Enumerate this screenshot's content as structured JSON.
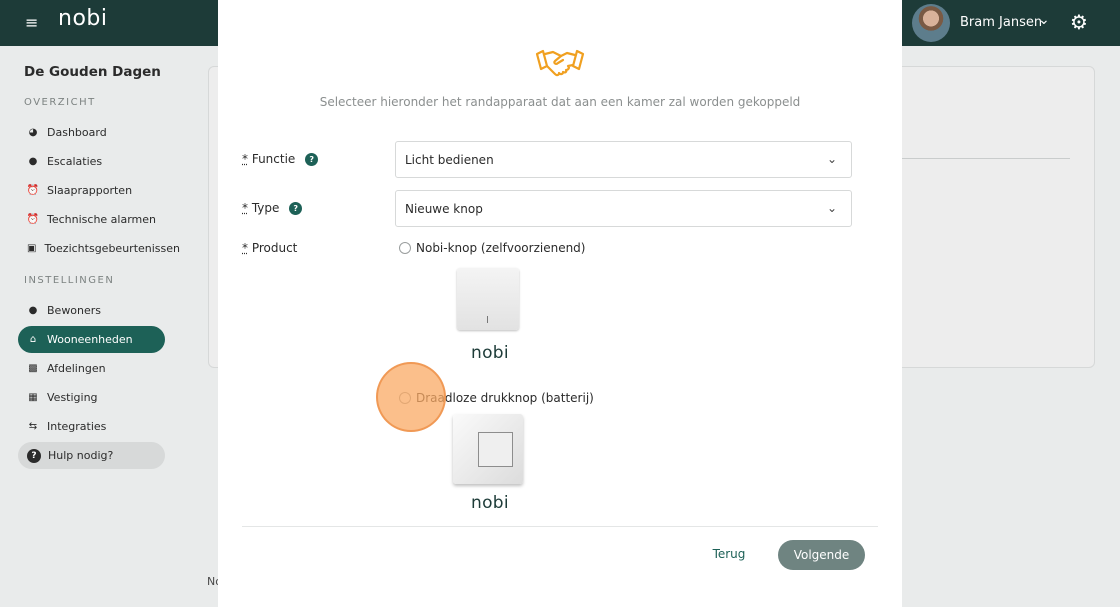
{
  "header": {
    "logo": "nobi",
    "user_name": "Bram Jansen"
  },
  "sidebar": {
    "org_name": "De Gouden Dagen",
    "sections": {
      "overview": "OVERZICHT",
      "settings": "INSTELLINGEN"
    },
    "items": [
      {
        "label": "Dashboard",
        "icon": "dashboard-icon"
      },
      {
        "label": "Escalaties",
        "icon": "bulb-icon"
      },
      {
        "label": "Slaaprapporten",
        "icon": "alarm-clock-icon"
      },
      {
        "label": "Technische alarmen",
        "icon": "alarm-clock-icon"
      },
      {
        "label": "Toezichtsgebeurtenissen",
        "icon": "monitor-icon"
      },
      {
        "label": "Bewoners",
        "icon": "users-icon"
      },
      {
        "label": "Wooneenheden",
        "icon": "home-icon"
      },
      {
        "label": "Afdelingen",
        "icon": "building-icon"
      },
      {
        "label": "Vestiging",
        "icon": "city-icon"
      },
      {
        "label": "Integraties",
        "icon": "swap-icon"
      },
      {
        "label": "Hulp nodig?",
        "icon": "question-icon"
      }
    ]
  },
  "background": {
    "footer_text": "No"
  },
  "modal": {
    "icon": "handshake-icon",
    "subtitle": "Selecteer hieronder het randapparaat dat aan een kamer zal worden gekoppeld",
    "fields": {
      "functie": {
        "required_mark": "*",
        "label": "Functie",
        "value": "Licht bedienen"
      },
      "type": {
        "required_mark": "*",
        "label": "Type",
        "value": "Nieuwe knop"
      },
      "product": {
        "required_mark": "*",
        "label": "Product"
      }
    },
    "products": [
      {
        "label": "Nobi-knop (zelfvoorzienend)",
        "brand": "nobi",
        "selected": false
      },
      {
        "label": "Draadloze drukknop (batterij)",
        "brand": "nobi",
        "selected": false
      }
    ],
    "buttons": {
      "back": "Terug",
      "next": "Volgende"
    }
  },
  "colors": {
    "topbar": "#1d3b38",
    "accent": "#1d6157",
    "primary_button": "#6f8481",
    "handshake": "#f0a020"
  }
}
